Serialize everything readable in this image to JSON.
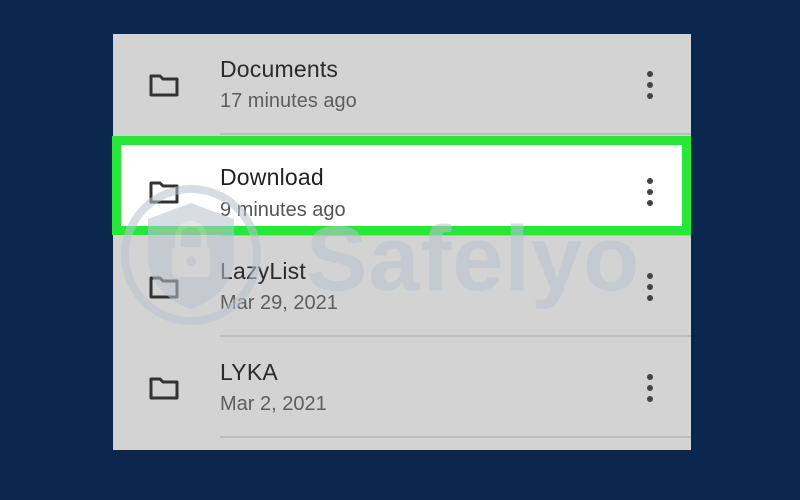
{
  "files": [
    {
      "name": "Documents",
      "modified": "17 minutes ago",
      "icon": "folder-icon",
      "selected": false
    },
    {
      "name": "Download",
      "modified": "9 minutes ago",
      "icon": "folder-icon",
      "selected": true
    },
    {
      "name": "LazyList",
      "modified": "Mar 29, 2021",
      "icon": "folder-icon",
      "selected": false
    },
    {
      "name": "LYKA",
      "modified": "Mar 2, 2021",
      "icon": "folder-icon",
      "selected": false
    }
  ],
  "watermark": {
    "text": "Safelyo",
    "icon": "shield-lock-icon"
  },
  "colors": {
    "background": "#0b274d",
    "list": "#d3d3d3",
    "highlight_border": "#29e63a",
    "highlight_fill": "#ffffff"
  }
}
